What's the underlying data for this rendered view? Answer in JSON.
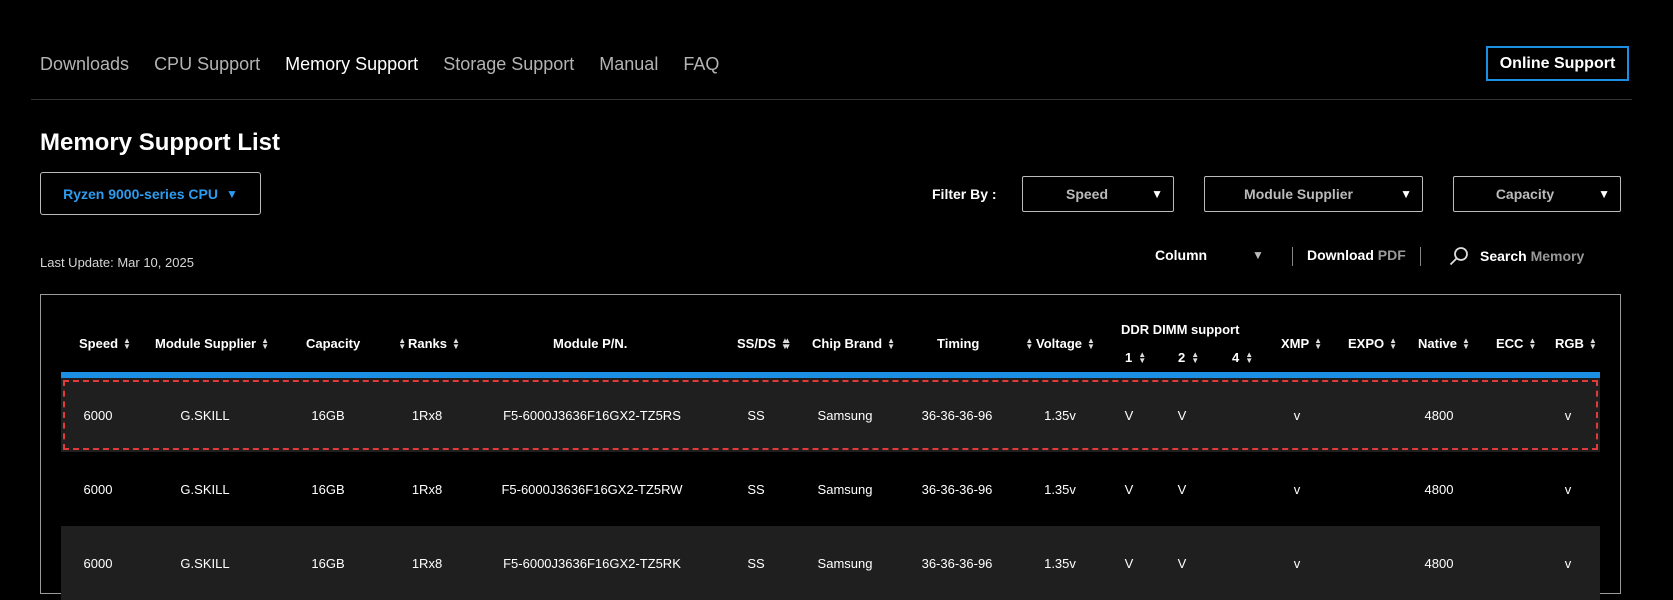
{
  "nav": {
    "items": [
      {
        "label": "Downloads",
        "active": false
      },
      {
        "label": "CPU Support",
        "active": false
      },
      {
        "label": "Memory Support",
        "active": true
      },
      {
        "label": "Storage Support",
        "active": false
      },
      {
        "label": "Manual",
        "active": false
      },
      {
        "label": "FAQ",
        "active": false
      }
    ],
    "online_support": "Online Support"
  },
  "page_title": "Memory Support List",
  "cpu_select": {
    "label": "Ryzen 9000-series CPU"
  },
  "filters": {
    "label": "Filter By :",
    "speed": "Speed",
    "supplier": "Module Supplier",
    "capacity": "Capacity"
  },
  "last_update": "Last Update: Mar 10, 2025",
  "toolbar": {
    "column": "Column",
    "download": "Download",
    "download_pdf": "PDF",
    "search": "Search",
    "search_target": "Memory"
  },
  "table": {
    "headers": {
      "speed": "Speed",
      "supplier": "Module Supplier",
      "capacity": "Capacity",
      "ranks": "Ranks",
      "pn": "Module P/N.",
      "ssds": "SS/DS",
      "chip": "Chip Brand",
      "timing": "Timing",
      "voltage": "Voltage",
      "ddr": "DDR DIMM support",
      "ddr1": "1",
      "ddr2": "2",
      "ddr4": "4",
      "xmp": "XMP",
      "expo": "EXPO",
      "native": "Native",
      "ecc": "ECC",
      "rgb": "RGB"
    },
    "rows": [
      {
        "speed": "6000",
        "supplier": "G.SKILL",
        "capacity": "16GB",
        "ranks": "1Rx8",
        "pn": "F5-6000J3636F16GX2-TZ5RS",
        "ssds": "SS",
        "chip": "Samsung",
        "timing": "36-36-36-96",
        "voltage": "1.35v",
        "ddr1": "V",
        "ddr2": "V",
        "ddr4": "",
        "xmp": "v",
        "expo": "",
        "native": "4800",
        "ecc": "",
        "rgb": "v"
      },
      {
        "speed": "6000",
        "supplier": "G.SKILL",
        "capacity": "16GB",
        "ranks": "1Rx8",
        "pn": "F5-6000J3636F16GX2-TZ5RW",
        "ssds": "SS",
        "chip": "Samsung",
        "timing": "36-36-36-96",
        "voltage": "1.35v",
        "ddr1": "V",
        "ddr2": "V",
        "ddr4": "",
        "xmp": "v",
        "expo": "",
        "native": "4800",
        "ecc": "",
        "rgb": "v"
      },
      {
        "speed": "6000",
        "supplier": "G.SKILL",
        "capacity": "16GB",
        "ranks": "1Rx8",
        "pn": "F5-6000J3636F16GX2-TZ5RK",
        "ssds": "SS",
        "chip": "Samsung",
        "timing": "36-36-36-96",
        "voltage": "1.35v",
        "ddr1": "V",
        "ddr2": "V",
        "ddr4": "",
        "xmp": "v",
        "expo": "",
        "native": "4800",
        "ecc": "",
        "rgb": "v"
      }
    ]
  },
  "colors": {
    "accent": "#1a8fe3",
    "cpu_select_text": "#2d9cee",
    "selection_outline": "#e03a3a",
    "row_shade": "#1f1f1f"
  }
}
